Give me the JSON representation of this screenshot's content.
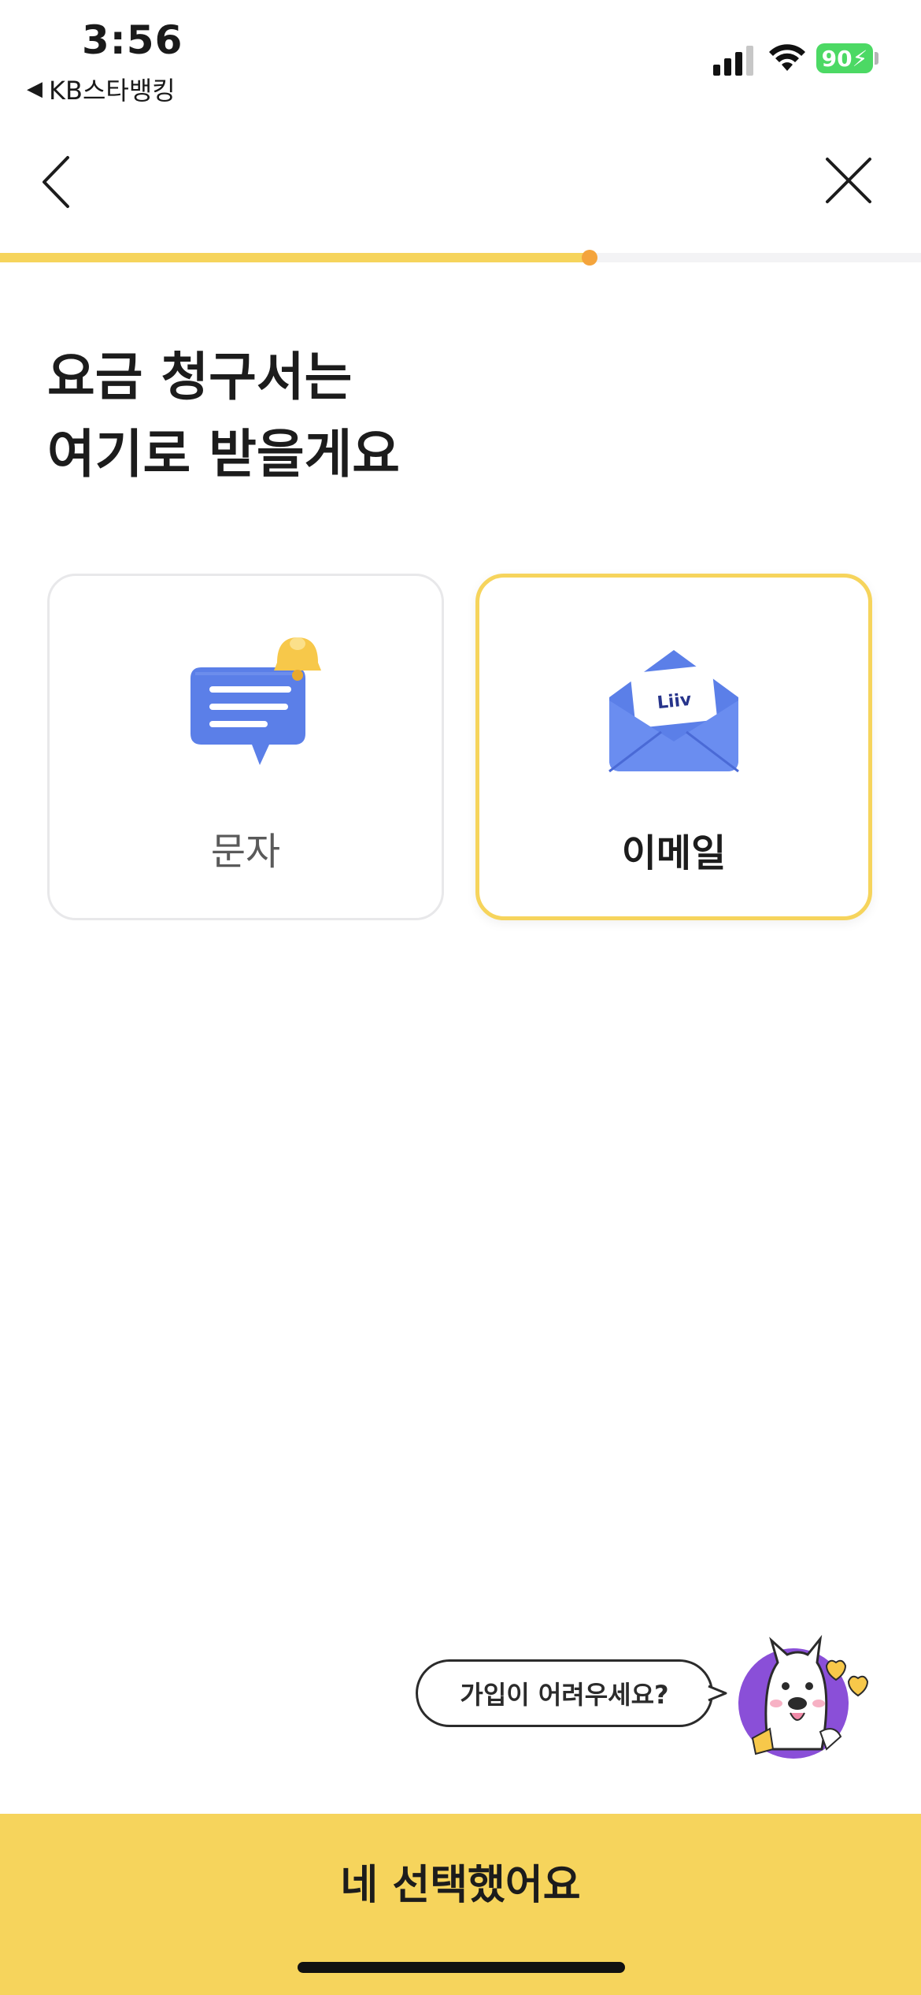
{
  "status_bar": {
    "time": "3:56",
    "back_app_label": "KB스타뱅킹",
    "battery_text": "90",
    "icons": [
      "signal-icon",
      "wifi-icon",
      "battery-icon"
    ]
  },
  "nav": {
    "back_icon": "chevron-left-icon",
    "close_icon": "close-icon"
  },
  "progress": {
    "value": 0.64,
    "track_color": "#f3f3f5",
    "fill_color": "#f6d45c",
    "dot_color": "#f4a43c"
  },
  "title": {
    "line1": "요금 청구서는",
    "line2": "여기로 받을게요"
  },
  "options": [
    {
      "label": "문자",
      "icon": "message-bell-icon",
      "selected": false
    },
    {
      "label": "이메일",
      "icon": "envelope-icon",
      "envelope_text": "Liiv",
      "selected": true
    }
  ],
  "help": {
    "bubble_text": "가입이 어려우세요?",
    "mascot": "mascot-avatar"
  },
  "cta": {
    "label": "네 선택했어요",
    "color": "#f6d45c"
  },
  "colors": {
    "accent": "#f6d45c",
    "icon_blue": "#5b7fe8",
    "purple": "#8a4fd8"
  }
}
